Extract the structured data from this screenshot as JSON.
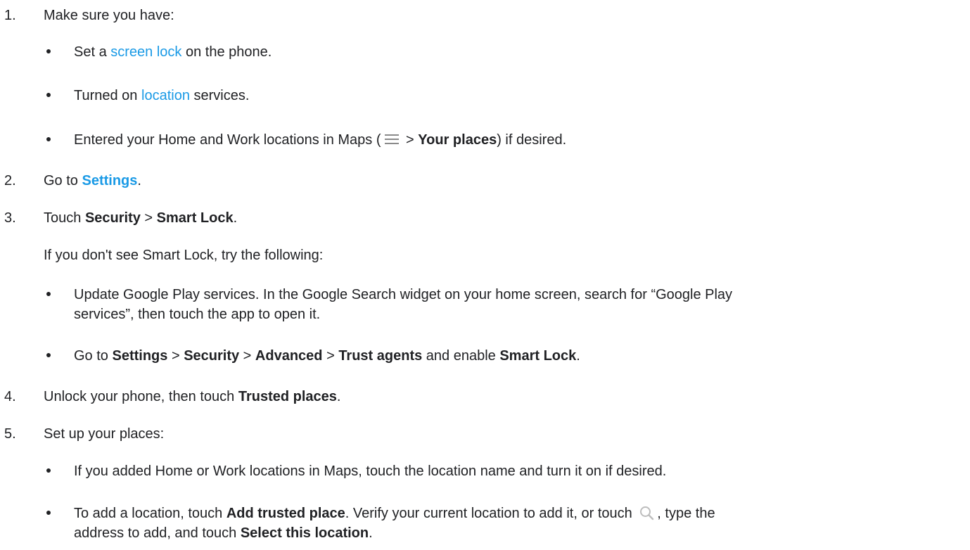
{
  "steps": [
    {
      "number": "1.",
      "text": "Make sure you have:"
    },
    {
      "number": "2.",
      "pre": "Go to ",
      "link": "Settings",
      "post": "."
    },
    {
      "number": "3.",
      "pre": "Touch ",
      "b1": "Security",
      "sep": " > ",
      "b2": "Smart Lock",
      "post": "."
    },
    {
      "number": "4.",
      "pre": "Unlock your phone, then touch ",
      "b1": "Trusted places",
      "post": "."
    },
    {
      "number": "5.",
      "text": "Set up your places:"
    }
  ],
  "step1_bullets": {
    "b1": {
      "pre": "Set a ",
      "link": "screen lock",
      "post": " on the phone."
    },
    "b2": {
      "pre": "Turned on ",
      "link": "location",
      "post": " services."
    },
    "b3": {
      "pre": "Entered your Home and Work locations in Maps (",
      "icon": "menu-icon",
      "mid": " > ",
      "bold": "Your places",
      "post": ") if desired."
    }
  },
  "step3_note": "If you don't see Smart Lock, try the following:",
  "step3_bullets": {
    "b1": {
      "line1": "Update Google Play services. In the Google Search widget on your home screen, search for “Google Play",
      "line2": "services”, then touch the app to open it."
    },
    "b2": {
      "pre": "Go to ",
      "s1": "Settings",
      "gt1": " > ",
      "s2": "Security",
      "gt2": " > ",
      "s3": "Advanced",
      "gt3": " > ",
      "s4": "Trust agents",
      "mid": " and enable ",
      "s5": "Smart Lock",
      "post": "."
    }
  },
  "step5_bullets": {
    "b1": {
      "text": "If you added Home or Work locations in Maps, touch the location name and turn it on if desired."
    },
    "b2": {
      "pre": "To add a location, touch ",
      "bold1": "Add trusted place",
      "mid": ". Verify your current location to add it, or touch ",
      "icon": "search-icon",
      "mid2": ", type the",
      "line2_pre": "address to add, and touch ",
      "bold2": "Select this location",
      "post": "."
    }
  },
  "colors": {
    "link": "#1a9ae6",
    "text": "#202124",
    "icon": "#8a8a8a"
  }
}
